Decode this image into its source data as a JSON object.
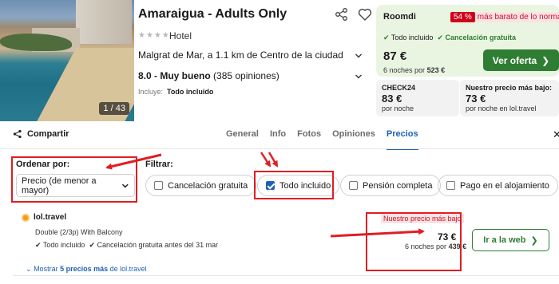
{
  "hotel": {
    "photo_counter": "1 / 43",
    "name": "Amaraigua - Adults Only",
    "type": "Hotel",
    "stars": "★★★★",
    "location": "Malgrat de Mar, a 1.1 km de Centro de la ciudad",
    "rating_score": "8.0 - Muy bueno",
    "rating_count": "(385 opiniones)",
    "includes_label": "Incluye:",
    "includes_value": "Todo incluido"
  },
  "top_offer": {
    "provider": "Roomdi",
    "badge_pct": "54 %",
    "badge_text": "más barato de lo normal",
    "feature_1": "Todo incluido",
    "feature_2": "Cancelación gratuita",
    "price": "87 €",
    "sub_prefix": "6 noches por",
    "sub_total": "523 €",
    "button_label": "Ver oferta"
  },
  "mini_offers": [
    {
      "name": "CHECK24",
      "price": "83 €",
      "sub": "por noche"
    },
    {
      "name": "Nuestro precio más bajo:",
      "price": "73 €",
      "sub": "por noche en lol.travel"
    }
  ],
  "nav": {
    "share_label": "Compartir",
    "tabs": [
      "General",
      "Info",
      "Fotos",
      "Opiniones",
      "Precios"
    ],
    "active_tab": "Precios"
  },
  "filters": {
    "sort_label": "Ordenar por:",
    "sort_value": "Precio (de menor a mayor)",
    "filter_label": "Filtrar:",
    "chips": [
      {
        "label": "Cancelación gratuita",
        "checked": false
      },
      {
        "label": "Todo incluido",
        "checked": true
      },
      {
        "label": "Pensión completa",
        "checked": false
      },
      {
        "label": "Pago en el alojamiento",
        "checked": false
      }
    ]
  },
  "deal": {
    "provider": "lol.travel",
    "room": "Double (2/3p) With Balcony",
    "feature_1": "Todo incluido",
    "feature_2": "Cancelación gratuita antes del 31 mar",
    "badge": "Nuestro precio más bajo",
    "price": "73 €",
    "sub_prefix": "6 noches por",
    "sub_total": "439 €",
    "button_label": "Ir a la web",
    "more_prefix": "Mostrar",
    "more_count": "5 precios más",
    "more_suffix": "de lol.travel"
  },
  "colors": {
    "accent_blue": "#1e62b4",
    "deal_green": "#2e7d32",
    "annotation_red": "#e01e24",
    "offer_bg": "#eaf5e1"
  }
}
